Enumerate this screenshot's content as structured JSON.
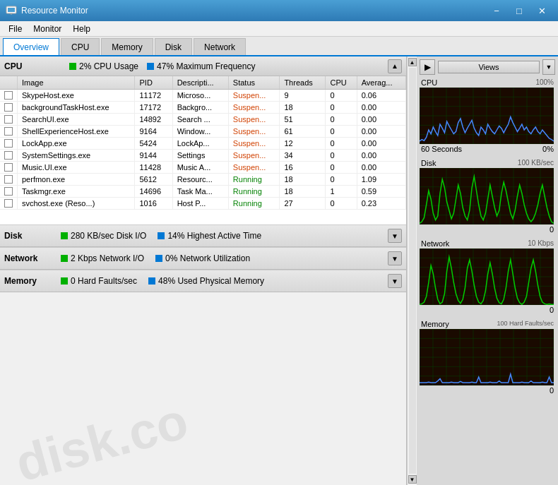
{
  "titlebar": {
    "icon": "monitor-icon",
    "title": "Resource Monitor",
    "minimize": "−",
    "maximize": "□",
    "close": "✕"
  },
  "menubar": {
    "items": [
      "File",
      "Monitor",
      "Help"
    ]
  },
  "tabs": {
    "items": [
      "Overview",
      "CPU",
      "Memory",
      "Disk",
      "Network"
    ],
    "active": "Overview"
  },
  "cpu_section": {
    "label": "CPU",
    "stat1_icon": "green",
    "stat1": "2% CPU Usage",
    "stat2_icon": "blue",
    "stat2": "47% Maximum Frequency"
  },
  "table": {
    "columns": [
      "",
      "Image",
      "PID",
      "Descripti...",
      "Status",
      "Threads",
      "CPU",
      "Averag..."
    ],
    "rows": [
      [
        "",
        "SkypeHost.exe",
        "11172",
        "Microso...",
        "Suspen...",
        "9",
        "0",
        "0.06"
      ],
      [
        "",
        "backgroundTaskHost.exe",
        "17172",
        "Backgro...",
        "Suspen...",
        "18",
        "0",
        "0.00"
      ],
      [
        "",
        "SearchUI.exe",
        "14892",
        "Search ...",
        "Suspen...",
        "51",
        "0",
        "0.00"
      ],
      [
        "",
        "ShellExperienceHost.exe",
        "9164",
        "Window...",
        "Suspen...",
        "61",
        "0",
        "0.00"
      ],
      [
        "",
        "LockApp.exe",
        "5424",
        "LockAp...",
        "Suspen...",
        "12",
        "0",
        "0.00"
      ],
      [
        "",
        "SystemSettings.exe",
        "9144",
        "Settings",
        "Suspen...",
        "34",
        "0",
        "0.00"
      ],
      [
        "",
        "Music.UI.exe",
        "11428",
        "Music A...",
        "Suspen...",
        "16",
        "0",
        "0.00"
      ],
      [
        "",
        "perfmon.exe",
        "5612",
        "Resourc...",
        "Running",
        "18",
        "0",
        "1.09"
      ],
      [
        "",
        "Taskmgr.exe",
        "14696",
        "Task Ma...",
        "Running",
        "18",
        "1",
        "0.59"
      ],
      [
        "",
        "svchost.exe (Reso...)",
        "1016",
        "Host P...",
        "Running",
        "27",
        "0",
        "0.23"
      ]
    ]
  },
  "disk_section": {
    "label": "Disk",
    "stat1": "280 KB/sec Disk I/O",
    "stat2": "14% Highest Active Time"
  },
  "network_section": {
    "label": "Network",
    "stat1": "2 Kbps Network I/O",
    "stat2": "0% Network Utilization"
  },
  "memory_section": {
    "label": "Memory",
    "stat1": "0 Hard Faults/sec",
    "stat2": "48% Used Physical Memory"
  },
  "right_panel": {
    "views_label": "Views",
    "charts": [
      {
        "label": "CPU",
        "max": "100%",
        "min": "0%",
        "duration": "60 Seconds",
        "color": "#4488ff",
        "grid_color": "#006000"
      },
      {
        "label": "Disk",
        "max": "100 KB/sec",
        "min": "0",
        "color": "#00cc00",
        "grid_color": "#006000"
      },
      {
        "label": "Network",
        "max": "10 Kbps",
        "min": "0",
        "color": "#00cc00",
        "grid_color": "#006000"
      },
      {
        "label": "Memory",
        "max": "100 Hard Faults/sec",
        "min": "0",
        "color": "#4488ff",
        "grid_color": "#006000"
      }
    ]
  }
}
